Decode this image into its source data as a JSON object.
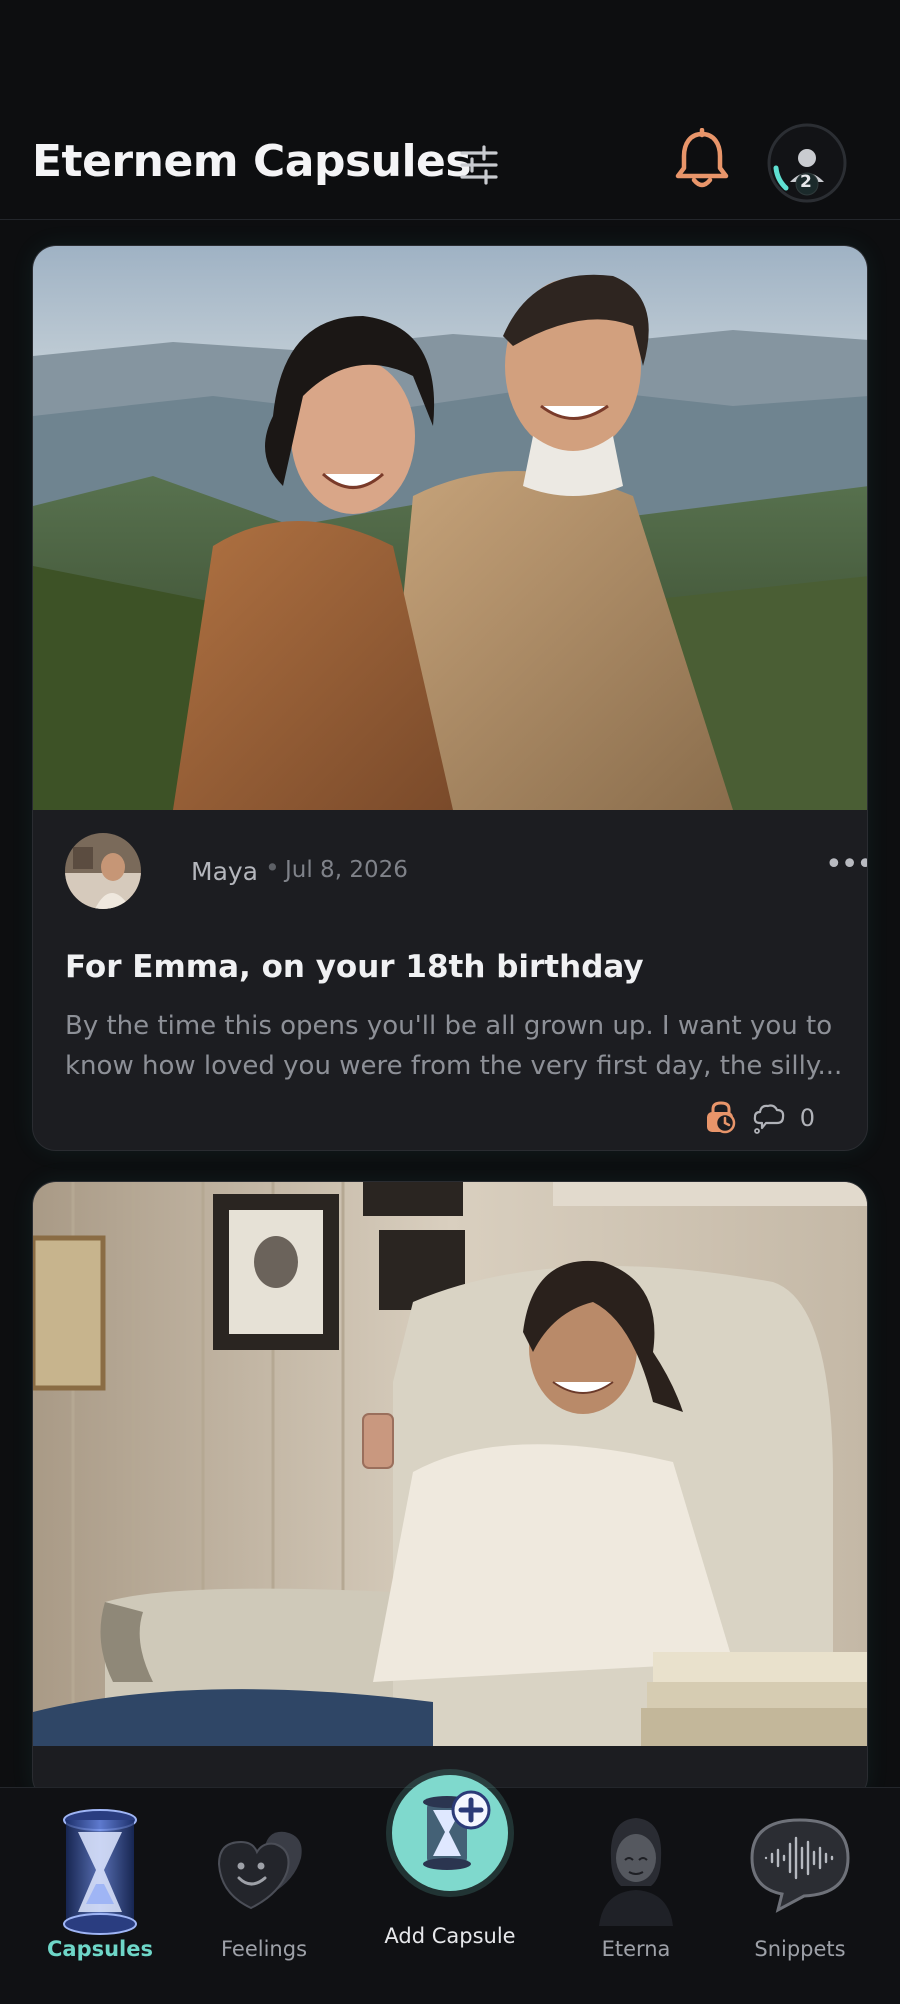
{
  "header": {
    "title": "Eternem Capsules",
    "notification_badge": "2"
  },
  "capsules": [
    {
      "author": "Maya",
      "separator": "•",
      "date": "Jul 8, 2026",
      "more": "•••",
      "title": "For Emma, on your 18th birthday",
      "excerpt": "By the time this opens you'll be all grown up. I want you to know how loved you were from the very first day, the silly...",
      "comment_count": "0",
      "icons": [
        "timelock-icon",
        "comment-cloud-icon"
      ]
    },
    {
      "photo": "woman-reading-phone-in-armchair"
    }
  ],
  "nav": {
    "items": [
      {
        "label": "Capsules",
        "icon": "hourglass-icon",
        "active": true
      },
      {
        "label": "Feelings",
        "icon": "hearts-icon",
        "active": false
      },
      {
        "label": "Add Capsule",
        "icon": "add-capsule-icon",
        "active": false
      },
      {
        "label": "Eterna",
        "icon": "eterna-avatar-icon",
        "active": false
      },
      {
        "label": "Snippets",
        "icon": "soundwave-bubble-icon",
        "active": false
      }
    ]
  },
  "colors": {
    "accent": "#6ed6c8",
    "bell": "#e8956a",
    "background": "#0d0e10",
    "card": "#1c1d21"
  }
}
